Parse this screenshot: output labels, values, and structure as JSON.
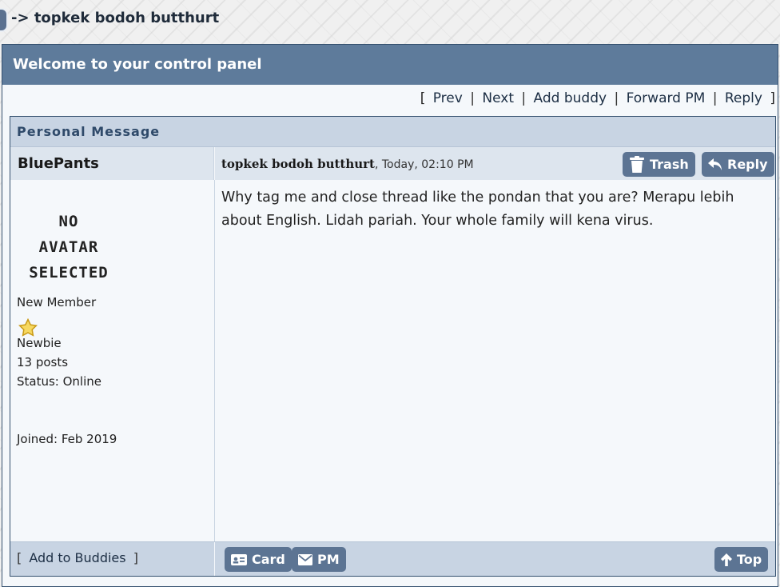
{
  "thread": {
    "title": "-> topkek bodoh butthurt"
  },
  "panel": {
    "header": "Welcome to your control panel"
  },
  "nav": {
    "open": "[",
    "close": "]",
    "sep": "|",
    "prev": "Prev",
    "next": "Next",
    "add_buddy": "Add buddy",
    "forward": "Forward PM",
    "reply": "Reply"
  },
  "message": {
    "section_title": "Personal Message",
    "author": "BluePants",
    "subject": "topkek bodoh butthurt",
    "date": ", Today, 02:10 PM",
    "trash_label": "Trash",
    "reply_label": "Reply",
    "body": "Why tag me and close thread like the pondan that you are? Merapu lebih about English. Lidah pariah. Your whole family will kena virus."
  },
  "user": {
    "avatar_line1": "NO AVATAR",
    "avatar_line2": "SELECTED",
    "group": "New Member",
    "rank": "Newbie",
    "posts": "13 posts",
    "status": "Status: Online",
    "joined": "Joined: Feb 2019"
  },
  "footer": {
    "add_buddies": "Add to Buddies",
    "card_label": "Card",
    "pm_label": "PM",
    "top_label": "Top"
  },
  "colors": {
    "header_bg": "#5e7b9b",
    "button_bg": "#5c7493",
    "row_bg": "#dde5ee",
    "section_bg": "#c8d4e3",
    "star": "#e8b923"
  },
  "icons": [
    "trash-icon",
    "reply-arrow-icon",
    "star-icon",
    "card-icon",
    "envelope-icon",
    "arrow-up-icon"
  ]
}
